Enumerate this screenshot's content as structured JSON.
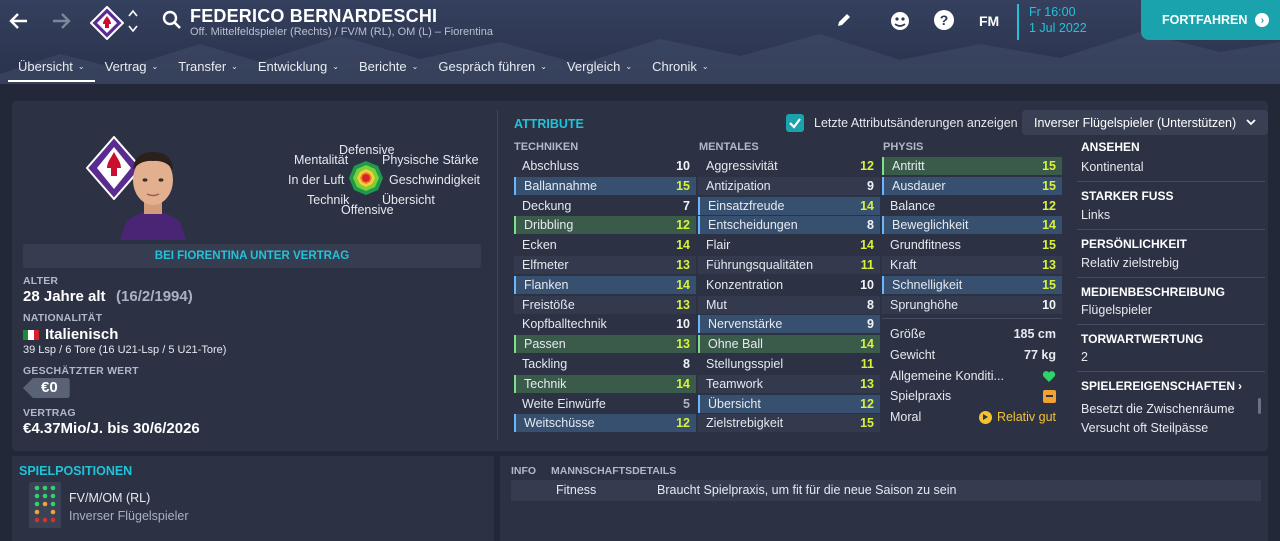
{
  "header": {
    "player_name": "FEDERICO BERNARDESCHI",
    "player_subtitle": "Off. Mittelfeldspieler (Rechts) / FV/M (RL), OM (L) – Fiorentina",
    "date_time": "Fr 16:00",
    "date": "1 Jul 2022",
    "fm_label": "FM",
    "help_label": "?",
    "continue_label": "FORTFAHREN"
  },
  "tabs": [
    {
      "label": "Übersicht"
    },
    {
      "label": "Vertrag"
    },
    {
      "label": "Transfer"
    },
    {
      "label": "Entwicklung"
    },
    {
      "label": "Berichte"
    },
    {
      "label": "Gespräch führen"
    },
    {
      "label": "Vergleich"
    },
    {
      "label": "Chronik"
    }
  ],
  "profile": {
    "wheel_labels": {
      "defensive": "Defensive",
      "mentality": "Mentalität",
      "physical": "Physische Stärke",
      "aerial": "In der Luft",
      "speed": "Geschwindigkeit",
      "technique": "Technik",
      "vision": "Übersicht",
      "offensive": "Offensive"
    },
    "contract_banner": "BEI FIORENTINA UNTER VERTRAG",
    "age_label": "ALTER",
    "age_value": "28 Jahre alt",
    "birth_date": "(16/2/1994)",
    "nationality_label": "NATIONALITÄT",
    "nationality_value": "Italienisch",
    "caps": "39 Lsp / 6 Tore (16 U21-Lsp / 5 U21-Tore)",
    "value_label": "GESCHÄTZTER WERT",
    "value_amount": "€0",
    "contract_label": "VERTRAG",
    "contract_value": "€4.37Mio/J. bis 30/6/2026"
  },
  "attributes": {
    "title": "ATTRIBUTE",
    "show_changes_label": "Letzte Attributsänderungen anzeigen",
    "role_dropdown": "Inverser Flügelspieler (Unterstützen)",
    "technical_header": "TECHNIKEN",
    "mental_header": "MENTALES",
    "physical_header": "PHYSIS",
    "technical": [
      {
        "name": "Abschluss",
        "value": "10"
      },
      {
        "name": "Ballannahme",
        "value": "15"
      },
      {
        "name": "Deckung",
        "value": "7"
      },
      {
        "name": "Dribbling",
        "value": "12"
      },
      {
        "name": "Ecken",
        "value": "14"
      },
      {
        "name": "Elfmeter",
        "value": "13"
      },
      {
        "name": "Flanken",
        "value": "14"
      },
      {
        "name": "Freistöße",
        "value": "13"
      },
      {
        "name": "Kopfballtechnik",
        "value": "10"
      },
      {
        "name": "Passen",
        "value": "13"
      },
      {
        "name": "Tackling",
        "value": "8"
      },
      {
        "name": "Technik",
        "value": "14"
      },
      {
        "name": "Weite Einwürfe",
        "value": "5"
      },
      {
        "name": "Weitschüsse",
        "value": "12"
      }
    ],
    "mental": [
      {
        "name": "Aggressivität",
        "value": "12"
      },
      {
        "name": "Antizipation",
        "value": "9"
      },
      {
        "name": "Einsatzfreude",
        "value": "14"
      },
      {
        "name": "Entscheidungen",
        "value": "8"
      },
      {
        "name": "Flair",
        "value": "14"
      },
      {
        "name": "Führungsqualitäten",
        "value": "11"
      },
      {
        "name": "Konzentration",
        "value": "10"
      },
      {
        "name": "Mut",
        "value": "8"
      },
      {
        "name": "Nervenstärke",
        "value": "9"
      },
      {
        "name": "Ohne Ball",
        "value": "14"
      },
      {
        "name": "Stellungsspiel",
        "value": "11"
      },
      {
        "name": "Teamwork",
        "value": "13"
      },
      {
        "name": "Übersicht",
        "value": "12"
      },
      {
        "name": "Zielstrebigkeit",
        "value": "15"
      }
    ],
    "physical": [
      {
        "name": "Antritt",
        "value": "15"
      },
      {
        "name": "Ausdauer",
        "value": "15"
      },
      {
        "name": "Balance",
        "value": "12"
      },
      {
        "name": "Beweglichkeit",
        "value": "14"
      },
      {
        "name": "Grundfitness",
        "value": "15"
      },
      {
        "name": "Kraft",
        "value": "13"
      },
      {
        "name": "Schnelligkeit",
        "value": "15"
      },
      {
        "name": "Sprunghöhe",
        "value": "10"
      }
    ],
    "extra": {
      "height_label": "Größe",
      "height_value": "185 cm",
      "weight_label": "Gewicht",
      "weight_value": "77 kg",
      "condition_label": "Allgemeine Konditi...",
      "practice_label": "Spielpraxis",
      "morale_label": "Moral",
      "morale_value": "Relativ gut"
    }
  },
  "right_column": {
    "reputation_label": "ANSEHEN",
    "reputation_value": "Kontinental",
    "foot_label": "STARKER FUSS",
    "foot_value": "Links",
    "personality_label": "PERSÖNLICHKEIT",
    "personality_value": "Relativ zielstrebig",
    "media_label": "MEDIENBESCHREIBUNG",
    "media_value": "Flügelspieler",
    "gk_label": "TORWARTWERTUNG",
    "gk_value": "2",
    "traits_label": "SPIELEREIGENSCHAFTEN",
    "traits": [
      "Besetzt die Zwischenräume",
      "Versucht oft Steilpässe"
    ]
  },
  "positions": {
    "title": "SPIELPOSITIONEN",
    "position": "FV/M/OM (RL)",
    "role": "Inverser Flügelspieler"
  },
  "info": {
    "info_header": "INFO",
    "team_header": "MANNSCHAFTSDETAILS",
    "fitness_label": "Fitness",
    "fitness_text": "Braucht Spielpraxis, um fit für die neue Saison zu sein"
  },
  "colors": {
    "accent": "#21c3d9",
    "continue_button": "#1aa3ad",
    "fiorentina_purple": "#5b2c8f",
    "attribute_high": "#d8f23a"
  }
}
